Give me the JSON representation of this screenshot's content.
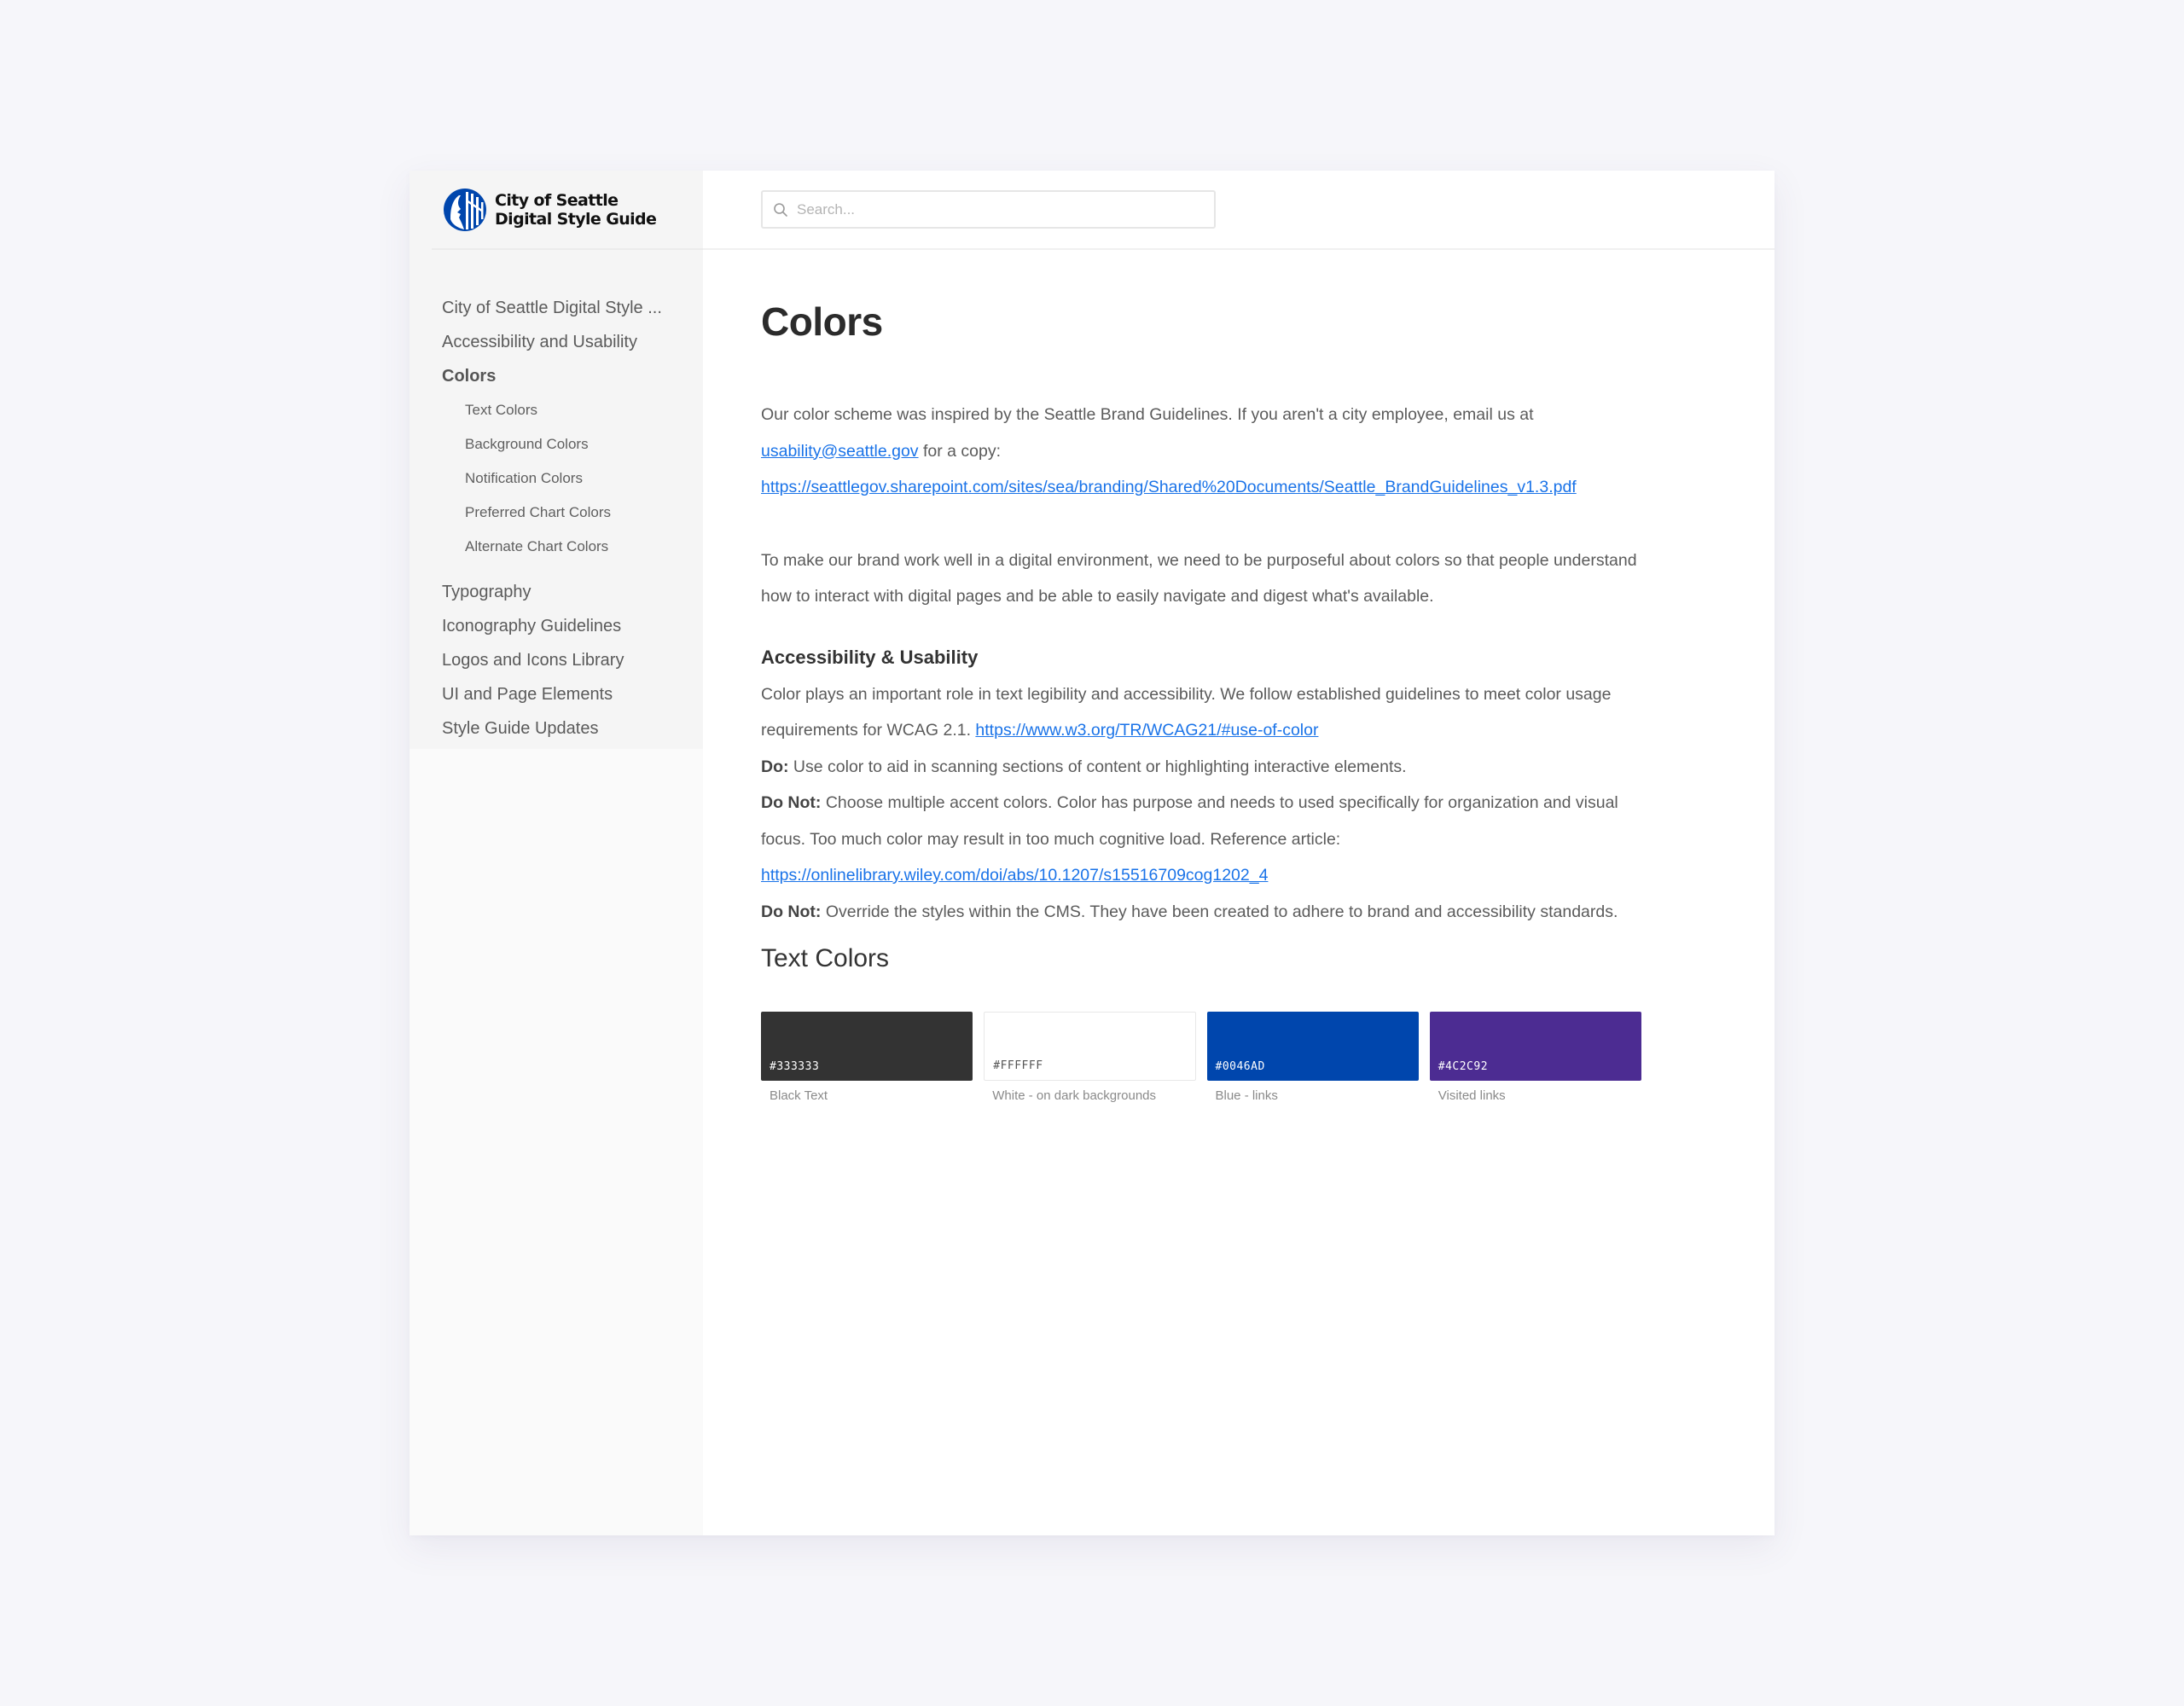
{
  "sidebar": {
    "logo": {
      "line1": "City of Seattle",
      "line2": "Digital Style Guide",
      "brand_color": "#0046AD"
    },
    "nav": [
      {
        "label": "City of Seattle Digital Style ...",
        "active": false
      },
      {
        "label": "Accessibility and Usability",
        "active": false
      },
      {
        "label": "Colors",
        "active": true,
        "children": [
          {
            "label": "Text Colors"
          },
          {
            "label": "Background Colors"
          },
          {
            "label": "Notification Colors"
          },
          {
            "label": "Preferred Chart Colors"
          },
          {
            "label": "Alternate Chart Colors"
          }
        ]
      },
      {
        "label": "Typography",
        "active": false
      },
      {
        "label": "Iconography Guidelines",
        "active": false
      },
      {
        "label": "Logos and Icons Library",
        "active": false
      },
      {
        "label": "UI and Page Elements",
        "active": false
      },
      {
        "label": "Style Guide Updates",
        "active": false
      }
    ]
  },
  "header": {
    "search_placeholder": "Search...",
    "search_value": ""
  },
  "main": {
    "title": "Colors",
    "intro": {
      "text1": "Our color scheme was inspired by the Seattle Brand Guidelines. If you aren't a city employee, email us at ",
      "email_link": "usability@seattle.gov",
      "text2": " for a copy:",
      "guidelines_link": "https://seattlegov.sharepoint.com/sites/sea/branding/Shared%20Documents/Seattle_BrandGuidelines_v1.3.pdf"
    },
    "paragraph2": "To make our brand work well in a digital environment, we need to be purposeful about colors so that people understand how to interact with digital pages and be able to easily navigate and digest what's available.",
    "accessibility": {
      "heading": "Accessibility & Usability",
      "text": "Color plays an important role in text legibility and accessibility. We follow established guidelines to meet color usage requirements for WCAG 2.1. ",
      "wcag_link": "https://www.w3.org/TR/WCAG21/#use-of-color",
      "do_label": "Do:",
      "do_text": " Use color to aid in scanning sections of content or highlighting interactive elements.",
      "donot1_label": "Do Not:",
      "donot1_text": " Choose multiple accent colors. Color has purpose and needs to used specifically for organization and visual focus. Too much color may result in too much cognitive load. Reference article: ",
      "article_link": "https://onlinelibrary.wiley.com/doi/abs/10.1207/s15516709cog1202_4",
      "donot2_label": "Do Not:",
      "donot2_text": " Override the styles within the CMS. They have been created to adhere to brand and accessibility standards."
    },
    "text_colors": {
      "heading": "Text Colors",
      "swatches": [
        {
          "hex": "#333333",
          "label": "Black Text",
          "color": "#333333",
          "text_color": "#ffffff"
        },
        {
          "hex": "#FFFFFF",
          "label": "White - on dark backgrounds",
          "color": "#FFFFFF",
          "text_color": "#555555"
        },
        {
          "hex": "#0046AD",
          "label": "Blue - links",
          "color": "#0046AD",
          "text_color": "#ffffff"
        },
        {
          "hex": "#4C2C92",
          "label": "Visited links",
          "color": "#4C2C92",
          "text_color": "#ffffff"
        }
      ]
    }
  }
}
